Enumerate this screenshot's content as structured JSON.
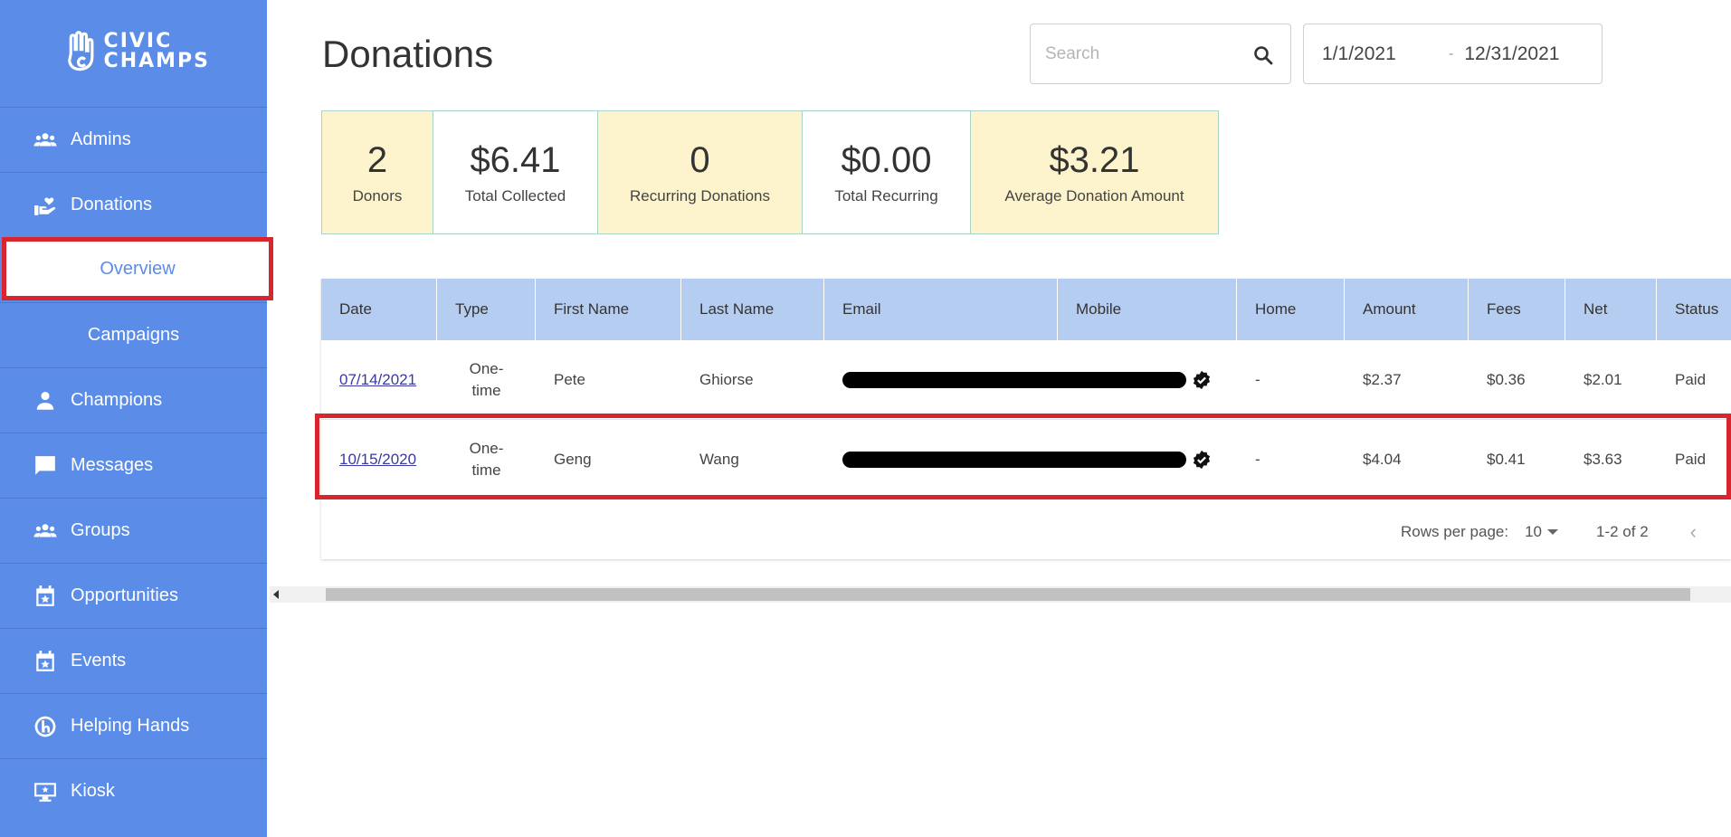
{
  "app": {
    "logo_line1": "CIVIC",
    "logo_line2": "CHAMPS"
  },
  "sidebar": {
    "items": [
      {
        "label": "Admins",
        "icon": "people-icon"
      },
      {
        "label": "Donations",
        "icon": "donation-hand-icon"
      },
      {
        "label": "Overview",
        "sub": true,
        "active": true
      },
      {
        "label": "Campaigns",
        "sub": true
      },
      {
        "label": "Champions",
        "icon": "person-icon"
      },
      {
        "label": "Messages",
        "icon": "chat-icon"
      },
      {
        "label": "Groups",
        "icon": "people-icon"
      },
      {
        "label": "Opportunities",
        "icon": "calendar-star-icon"
      },
      {
        "label": "Events",
        "icon": "calendar-star-icon"
      },
      {
        "label": "Helping Hands",
        "icon": "helping-hands-icon"
      },
      {
        "label": "Kiosk",
        "icon": "kiosk-icon"
      }
    ]
  },
  "header": {
    "title": "Donations",
    "search_placeholder": "Search",
    "date_start": "1/1/2021",
    "date_separator": "-",
    "date_end": "12/31/2021"
  },
  "stats": [
    {
      "value": "2",
      "label": "Donors"
    },
    {
      "value": "$6.41",
      "label": "Total Collected"
    },
    {
      "value": "0",
      "label": "Recurring Donations"
    },
    {
      "value": "$0.00",
      "label": "Total Recurring"
    },
    {
      "value": "$3.21",
      "label": "Average Donation Amount"
    }
  ],
  "table": {
    "columns": [
      "Date",
      "Type",
      "First Name",
      "Last Name",
      "Email",
      "Mobile",
      "Home",
      "Amount",
      "Fees",
      "Net",
      "Status"
    ],
    "rows": [
      {
        "date": "07/14/2021",
        "type1": "One-",
        "type2": "time",
        "first": "Pete",
        "last": "Ghiorse",
        "home": "-",
        "amount": "$2.37",
        "fees": "$0.36",
        "net": "$2.01",
        "status": "Paid"
      },
      {
        "date": "10/15/2020",
        "type1": "One-",
        "type2": "time",
        "first": "Geng",
        "last": "Wang",
        "home": "-",
        "amount": "$4.04",
        "fees": "$0.41",
        "net": "$3.63",
        "status": "Paid"
      }
    ]
  },
  "pager": {
    "rows_per_page_label": "Rows per page:",
    "rows_per_page_value": "10",
    "range": "1-2 of 2",
    "prev_glyph": "‹"
  },
  "colors": {
    "sidebar": "#5b8de8",
    "table_header": "#b6cdf2",
    "stat_yellow": "#fdf3cd",
    "highlight": "#d9262e"
  }
}
